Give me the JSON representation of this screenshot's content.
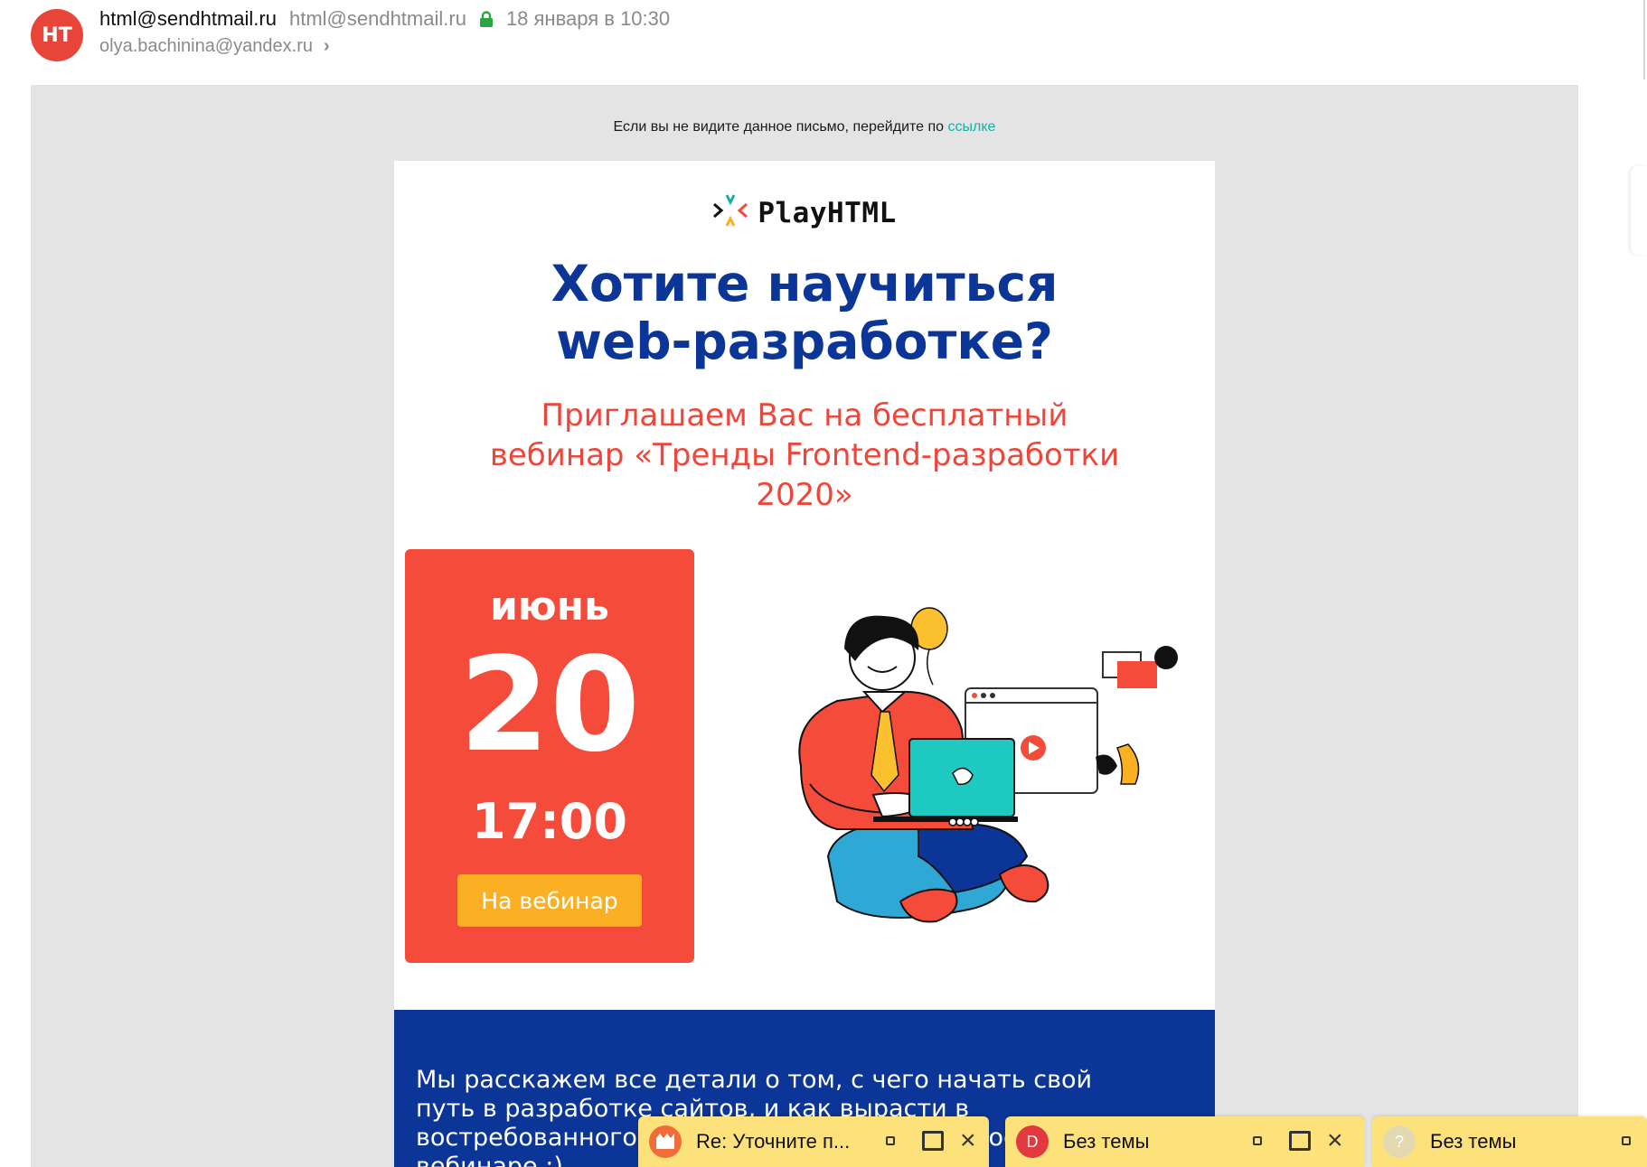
{
  "header": {
    "avatar_initials": "НТ",
    "avatar_color": "#e8443a",
    "sender_name": "html@sendhtmail.ru",
    "sender_email": "html@sendhtmail.ru",
    "secure_icon": "lock-icon",
    "date": "18 января в 10:30",
    "recipient": "olya.bachinina@yandex.ru"
  },
  "email": {
    "preheader_text": "Если вы не видите данное письмо, перейдите по",
    "preheader_link": "ссылке",
    "logo_text": "PlayHTML",
    "headline_line1": "Хотите научиться",
    "headline_line2": "web-разработке?",
    "subheadline": "Приглашаем Вас на бесплатный вебинар «Тренды Frontend-разработки 2020»",
    "event": {
      "month": "июнь",
      "day": "20",
      "time": "17:00",
      "button_label": "На вебинар"
    },
    "body_text": "Мы расскажем все детали о том, с чего начать свой путь в разработке сайтов, и как вырасти в востребованного специалиста. Все подробности на вебинаре :)",
    "colors": {
      "headline": "#0b3596",
      "accent_red": "#f44b3a",
      "button": "#fbb024",
      "link": "#16b0a9",
      "blue_section": "#0b3596"
    }
  },
  "compose_tabs": [
    {
      "title": "Re: Уточните п...",
      "avatar_letter": "",
      "avatar_color": "#f26b3a"
    },
    {
      "title": "Без темы",
      "avatar_letter": "D",
      "avatar_color": "#e0393e"
    },
    {
      "title": "Без темы",
      "avatar_letter": "?",
      "avatar_color": "#cfcfcf"
    }
  ]
}
